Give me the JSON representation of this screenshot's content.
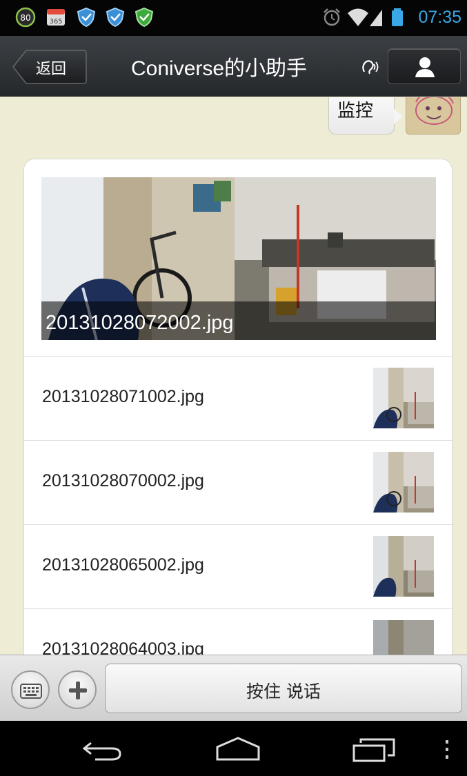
{
  "status_bar": {
    "badge_text": "80",
    "calendar_text": "365",
    "time": "07:35",
    "icons": [
      "battery-saver-icon",
      "calendar-icon",
      "shield-icon",
      "shield-icon",
      "shield-check-icon",
      "alarm-icon",
      "wifi-icon",
      "signal-icon",
      "battery-icon"
    ]
  },
  "header": {
    "back_label": "返回",
    "title": "Coniverse的小助手",
    "earpiece_icon": "earpiece-icon",
    "profile_icon": "person-icon"
  },
  "chat": {
    "outgoing_message": "监控",
    "news_card": {
      "cover_caption": "20131028072002.jpg",
      "items": [
        {
          "label": "20131028071002.jpg"
        },
        {
          "label": "20131028070002.jpg"
        },
        {
          "label": "20131028065002.jpg"
        },
        {
          "label": "20131028064003.jpg"
        }
      ]
    }
  },
  "input_bar": {
    "keyboard_icon": "keyboard-icon",
    "plus_icon": "plus-icon",
    "talk_label": "按住 说话"
  },
  "nav_bar": {
    "icons": [
      "back-icon",
      "home-icon",
      "recent-apps-icon",
      "menu-icon"
    ]
  },
  "colors": {
    "status_time": "#3aa7e6",
    "title_bar": "#2f3236",
    "chat_background": "#efecd6",
    "card_background": "#ffffff"
  }
}
